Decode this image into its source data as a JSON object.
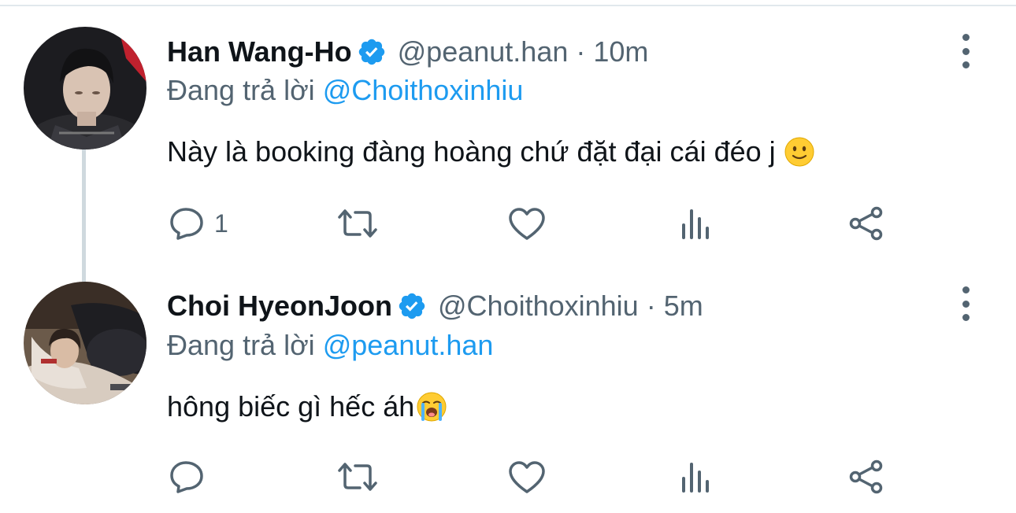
{
  "tweets": [
    {
      "name": "Han Wang-Ho",
      "handle": "@peanut.han",
      "separator": "·",
      "time": "10m",
      "reply_prefix": "Đang trả lời",
      "reply_to": "@Choithoxinhiu",
      "text": "Này là booking đàng hoàng chứ đặt đại cái đéo j",
      "emoji": "slightly-smiling-face",
      "reply_count": "1"
    },
    {
      "name": "Choi HyeonJoon",
      "handle": "@Choithoxinhiu",
      "separator": "·",
      "time": "5m",
      "reply_prefix": "Đang trả lời",
      "reply_to": "@peanut.han",
      "text": "hông biếc gì hếc áh",
      "emoji": "loudly-crying-face",
      "reply_count": ""
    }
  ],
  "colors": {
    "accent": "#1d9bf0",
    "secondary_text": "#536471",
    "primary_text": "#0f1419",
    "thread_line": "#cfd9de"
  },
  "icons": [
    "reply-icon",
    "retweet-icon",
    "like-icon",
    "views-icon",
    "share-icon",
    "more-icon",
    "verified-badge-icon"
  ]
}
